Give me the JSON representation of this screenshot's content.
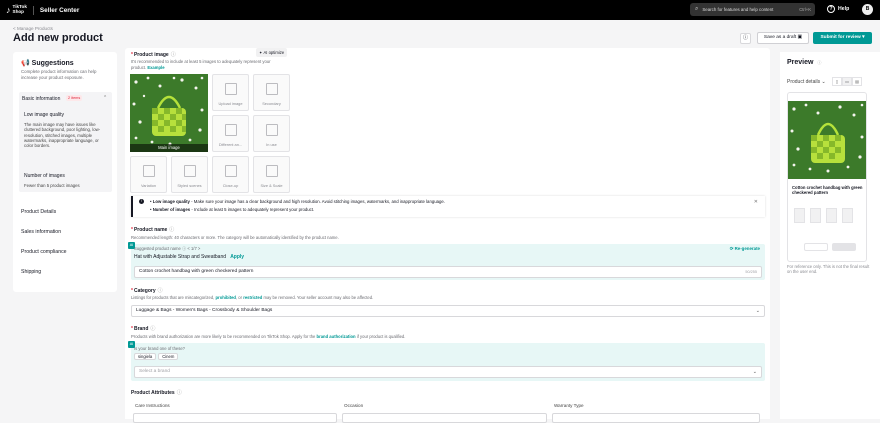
{
  "topbar": {
    "logo_line1": "TikTok",
    "logo_line2": "Shop",
    "app_name": "Seller Center",
    "search_placeholder": "Search for features and help content",
    "search_shortcut": "Ctrl+K",
    "help_label": "Help",
    "avatar_initial": "B"
  },
  "header": {
    "breadcrumb": "< Manage Products",
    "title": "Add new product",
    "save_draft_label": "Save as a draft",
    "submit_label": "Submit for review"
  },
  "suggestions": {
    "title": "Suggestions",
    "description": "Complete product information can help increase your product exposure.",
    "basic_info": {
      "label": "Basic information",
      "badge": "2 items",
      "items": [
        {
          "title": "Low image quality",
          "description": "The main image may have issues like cluttered background, poor lighting, low-resolution, stitched images, multiple watermarks, inappropriate language, or color borders."
        },
        {
          "title": "Number of images",
          "description": "Fewer than 5 product images"
        }
      ]
    },
    "sections": [
      "Product Details",
      "Sales information",
      "Product compliance",
      "Shipping"
    ]
  },
  "product_image": {
    "title": "Product image",
    "ai_optimize": "AI optimize",
    "description": "It's recommended to include at least 5 images to adequately represent your product.",
    "example_link": "Example",
    "main_label": "Main image",
    "slots": [
      "Upload image",
      "Secondary",
      "Different an...",
      "In use",
      "Variation",
      "Styled scenes",
      "Close-up",
      "Size & Scale"
    ]
  },
  "warning": {
    "line1_title": "Low image quality",
    "line1_text": "Make sure your image has a clear background and high resolution. Avoid stitching images, watermarks, and inappropriate language.",
    "line2_title": "Number of images",
    "line2_text": "Include at least 5 images to adequately represent your product."
  },
  "product_name": {
    "title": "Product name",
    "description": "Recommended length: 40 characters or more. The category will be automatically identified by the product name.",
    "suggested_label": "Suggested product name",
    "suggested_pager": "< 1/7 >",
    "regenerate": "Re-generate",
    "suggestion": "Hat with Adjustable Strap and Sweatband",
    "apply": "Apply",
    "value": "Cotton crochet handbag with green checkered pattern",
    "counter": "50/255"
  },
  "category": {
    "title": "Category",
    "description_pre": "Listings for products that are miscategorized, ",
    "prohibited": "prohibited",
    "description_mid": ", or ",
    "restricted": "restricted",
    "description_post": " may be removed. Your seller account may also be affected.",
    "value": "Luggage & Bags - Women's Bags - Crossbody & Shoulder Bags"
  },
  "brand": {
    "title": "Brand",
    "description_pre": "Products with brand authorization are more likely to be recommended on TikTok Shop. Apply for the ",
    "auth_link": "brand authorization",
    "description_post": " if your product is qualified.",
    "question": "Is your brand one of these?",
    "chips": [
      "singiela",
      "Cinem"
    ],
    "placeholder": "Select a brand"
  },
  "attributes": {
    "title": "Product Attributes",
    "columns": [
      "Care Instructions",
      "Occasion",
      "Warranty Type"
    ]
  },
  "preview": {
    "title": "Preview",
    "label": "Product details",
    "product_name": "Cotton crochet handbag with green checkered pattern",
    "note": "For reference only. This is not the final result on the user end."
  }
}
